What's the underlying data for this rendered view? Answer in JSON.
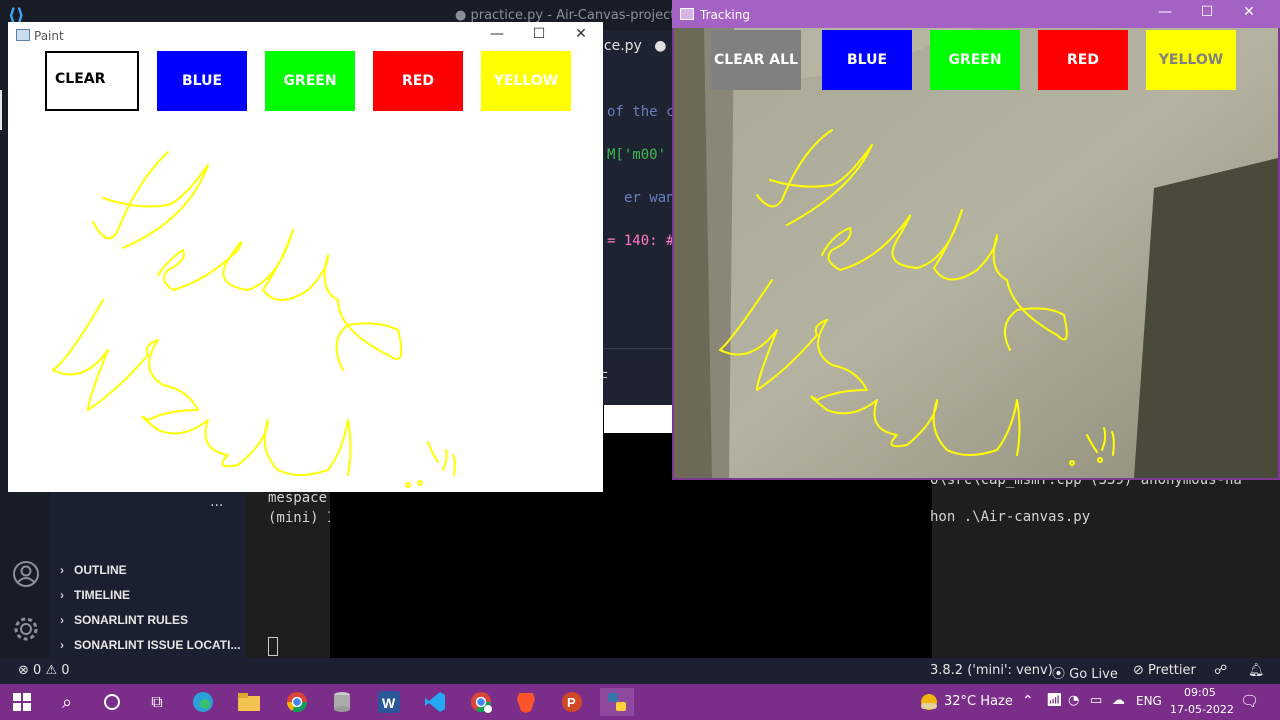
{
  "vscode": {
    "title": "● practice.py - Air-Canvas-project-m",
    "tab_label": "ice.py",
    "code_lines": [
      {
        "text": "of the c",
        "color": "#6a7dbd"
      },
      {
        "text": "M['m00'",
        "color": "#3fb950"
      },
      {
        "text": "er wants",
        "color": "#6a7dbd"
      },
      {
        "text": "= 140:  #",
        "color": "#ff79c6"
      }
    ],
    "panel_tab": "L",
    "terminal_left": [
      "mespace",
      "(mini) I"
    ],
    "terminal_right": [
      "o\\src\\cap_msmf.cpp (339) anonymous-na",
      "hon .\\Air-canvas.py"
    ],
    "sidebar_dots": "...",
    "sidebar_sections": [
      "OUTLINE",
      "TIMELINE",
      "SONARLINT RULES",
      "SONARLINT ISSUE LOCATI..."
    ],
    "status": {
      "errors": "0",
      "warnings": "0",
      "python_env": "3.8.2 ('mini': venv)",
      "go_live": "Go Live",
      "prettier": "Prettier"
    }
  },
  "paint": {
    "title": "Paint",
    "buttons": [
      {
        "label": "CLEAR",
        "bg": "#ffffff",
        "fg": "#000000"
      },
      {
        "label": "BLUE",
        "bg": "#0000ff",
        "fg": "#ffffff"
      },
      {
        "label": "GREEN",
        "bg": "#00ff00",
        "fg": "#ffffff"
      },
      {
        "label": "RED",
        "bg": "#ff0000",
        "fg": "#ffffff"
      },
      {
        "label": "YELLOW",
        "bg": "#ffff00",
        "fg": "#ffffff"
      }
    ],
    "ink_color": "#ffff00"
  },
  "tracking": {
    "title": "Tracking",
    "buttons": [
      {
        "label": "CLEAR ALL",
        "bg": "#808080",
        "fg": "#ffffff"
      },
      {
        "label": "BLUE",
        "bg": "#0000ff",
        "fg": "#ffffff"
      },
      {
        "label": "GREEN",
        "bg": "#00ff00",
        "fg": "#ffffff"
      },
      {
        "label": "RED",
        "bg": "#ff0000",
        "fg": "#ffffff"
      },
      {
        "label": "YELLOW",
        "bg": "#ffff00",
        "fg": "#808080"
      }
    ]
  },
  "window_controls": {
    "minimize": "—",
    "maximize": "☐",
    "close": "✕"
  },
  "taskbar": {
    "apps": [
      "start-icon",
      "search-icon",
      "cortana-icon",
      "task-view-icon",
      "edge-icon",
      "file-explorer-icon",
      "chrome-icon",
      "database-icon",
      "word-icon",
      "vscode-icon",
      "chrome-profile-icon",
      "brave-icon",
      "powerpoint-icon",
      "python-icon"
    ],
    "weather": "32°C  Haze",
    "language": "ENG",
    "time": "09:05",
    "date": "17-05-2022"
  }
}
